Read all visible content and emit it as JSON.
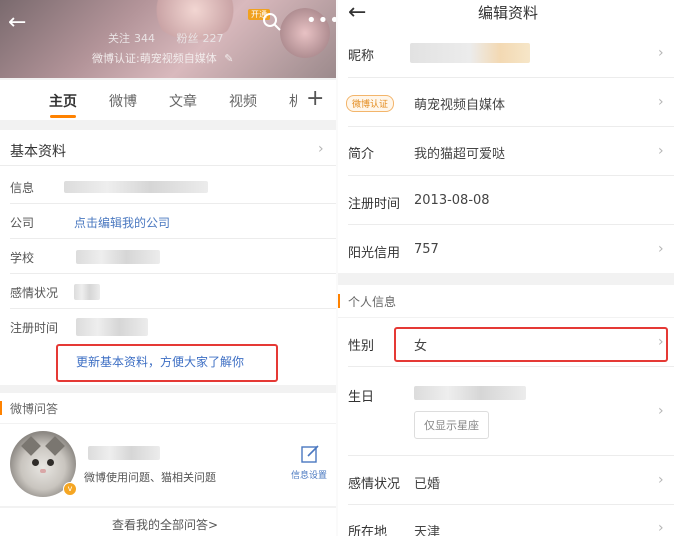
{
  "left": {
    "header": {
      "vip_badge": "开通",
      "following_label": "关注",
      "following_count": "344",
      "followers_label": "粉丝",
      "followers_count": "227",
      "verification": "微博认证:萌宠视频自媒体"
    },
    "tabs": [
      "主页",
      "微博",
      "文章",
      "视频",
      "机"
    ],
    "basic_info": {
      "title": "基本资料",
      "rows": [
        {
          "label": "信息",
          "value": ""
        },
        {
          "label": "公司",
          "value": "点击编辑我的公司"
        },
        {
          "label": "学校",
          "value": ""
        },
        {
          "label": "感情状况",
          "value": ""
        },
        {
          "label": "注册时间",
          "value": ""
        }
      ],
      "update_link": "更新基本资料，方便大家了解你"
    },
    "qa": {
      "title": "微博问答",
      "topics": "微博使用问题、猫相关问题",
      "settings_label": "信息设置",
      "view_all": "查看我的全部问答>"
    }
  },
  "right": {
    "title": "编辑资料",
    "rows": {
      "nickname_label": "昵称",
      "weibo_badge": "微博认证",
      "weibo_value": "萌宠视频自媒体",
      "intro_label": "简介",
      "intro_value": "我的猫超可爱哒",
      "reg_label": "注册时间",
      "reg_value": "2013-08-08",
      "credit_label": "阳光信用",
      "credit_value": "757"
    },
    "personal": {
      "title": "个人信息",
      "gender_label": "性别",
      "gender_value": "女",
      "birthday_label": "生日",
      "zodiac_chip": "仅显示星座",
      "relationship_label": "感情状况",
      "relationship_value": "已婚",
      "location_label": "所在地",
      "location_value": "天津"
    }
  },
  "colors": {
    "accent": "#ff8200",
    "link": "#4a78c0",
    "highlight_box": "#e53935"
  }
}
